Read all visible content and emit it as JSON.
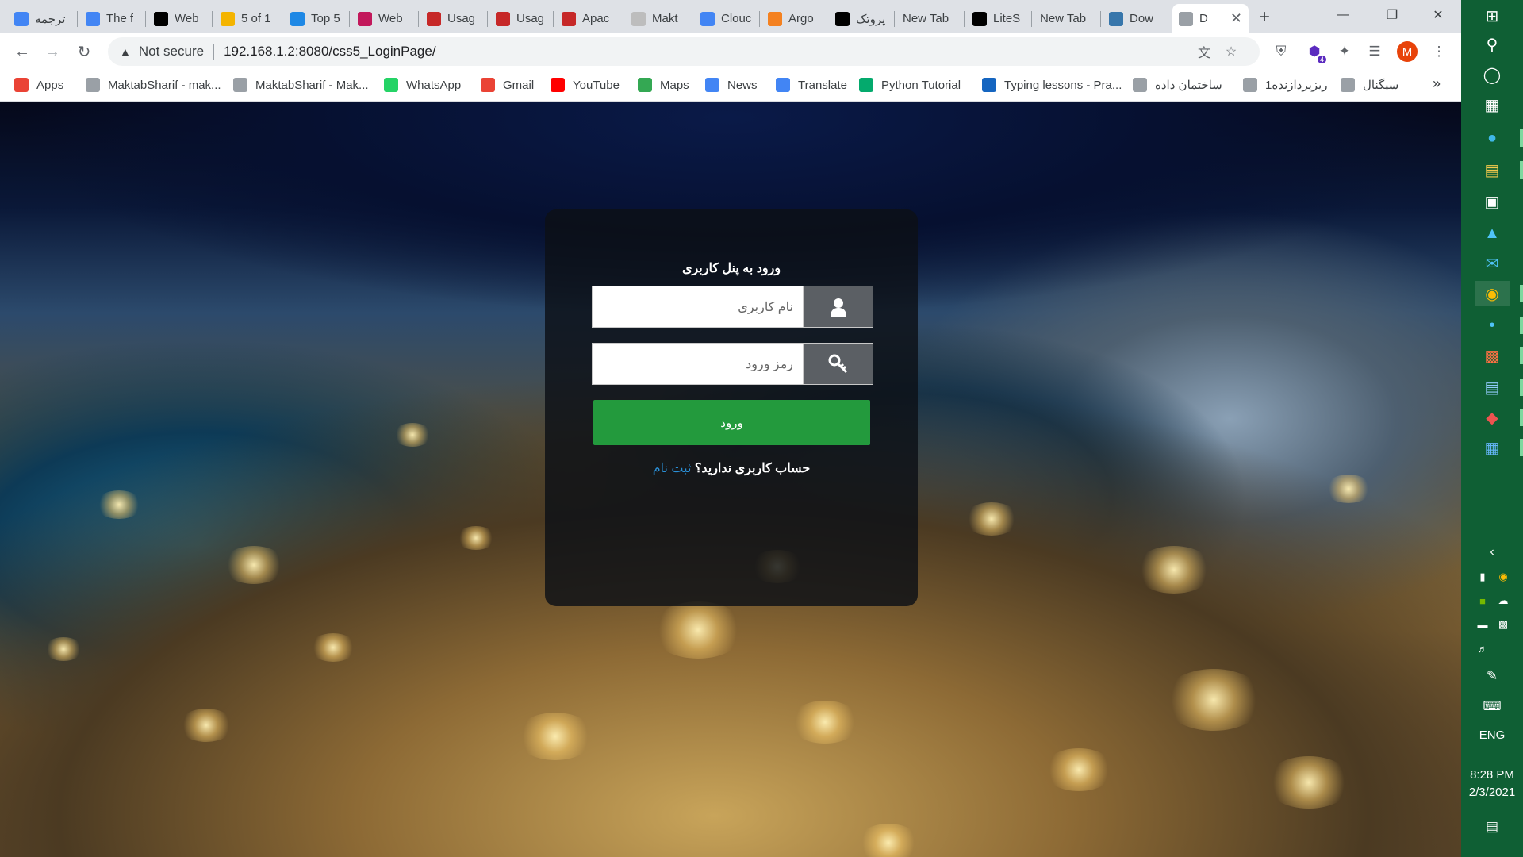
{
  "browser": {
    "tabs": [
      {
        "title": "ترجمه",
        "favicon": "translate-icon",
        "color": "#4285f4"
      },
      {
        "title": "The f",
        "favicon": "google-icon",
        "color": "#4285f4"
      },
      {
        "title": "Web",
        "favicon": "wikipedia-icon",
        "color": "#000000"
      },
      {
        "title": "5 of 1",
        "favicon": "mail-icon",
        "color": "#f4b400"
      },
      {
        "title": "Top 5",
        "favicon": "site-icon",
        "color": "#1e88e5"
      },
      {
        "title": "Web",
        "favicon": "site-icon",
        "color": "#c2185b"
      },
      {
        "title": "Usag",
        "favicon": "w3techs-icon",
        "color": "#c62828"
      },
      {
        "title": "Usag",
        "favicon": "w3techs-icon",
        "color": "#c62828"
      },
      {
        "title": "Apac",
        "favicon": "w3techs-icon",
        "color": "#c62828"
      },
      {
        "title": "Makt",
        "favicon": "globe-icon",
        "color": "#bdbdbd"
      },
      {
        "title": "Clouc",
        "favicon": "google-icon",
        "color": "#4285f4"
      },
      {
        "title": "Argo",
        "favicon": "cloudflare-icon",
        "color": "#f48120"
      },
      {
        "title": "پروتک",
        "favicon": "wikipedia-icon",
        "color": "#000000"
      },
      {
        "title": "New Tab",
        "favicon": "",
        "color": ""
      },
      {
        "title": "LiteS",
        "favicon": "wikipedia-icon",
        "color": "#000000"
      },
      {
        "title": "New Tab",
        "favicon": "",
        "color": ""
      },
      {
        "title": "Dow",
        "favicon": "python-icon",
        "color": "#3776ab"
      },
      {
        "title": "D",
        "favicon": "globe-icon",
        "color": "#9aa0a6",
        "active": true
      }
    ],
    "new_tab_symbol": "+",
    "address": {
      "security_label": "Not secure",
      "url": "192.168.1.2:8080/css5_LoginPage/"
    },
    "profile_initial": "M",
    "extension_badge": "4",
    "bookmarks": [
      {
        "label": "Apps",
        "icon": "apps-grid-icon",
        "color": "#ea4335"
      },
      {
        "label": "MaktabSharif - mak...",
        "icon": "globe-icon",
        "color": "#9aa0a6"
      },
      {
        "label": "MaktabSharif - Mak...",
        "icon": "globe-icon",
        "color": "#9aa0a6"
      },
      {
        "label": "WhatsApp",
        "icon": "whatsapp-icon",
        "color": "#25d366"
      },
      {
        "label": "Gmail",
        "icon": "gmail-icon",
        "color": "#ea4335"
      },
      {
        "label": "YouTube",
        "icon": "youtube-icon",
        "color": "#ff0000"
      },
      {
        "label": "Maps",
        "icon": "maps-icon",
        "color": "#34a853"
      },
      {
        "label": "News",
        "icon": "news-icon",
        "color": "#4285f4"
      },
      {
        "label": "Translate",
        "icon": "translate-icon",
        "color": "#4285f4"
      },
      {
        "label": "Python Tutorial",
        "icon": "w3schools-icon",
        "color": "#04aa6d"
      },
      {
        "label": "Typing lessons - Pra...",
        "icon": "typing-icon",
        "color": "#1565c0"
      },
      {
        "label": "ساختمان داده",
        "icon": "bank-icon",
        "color": "#9aa0a6"
      },
      {
        "label": "ریزپردازنده1",
        "icon": "bank-icon",
        "color": "#9aa0a6"
      },
      {
        "label": "سیگنال",
        "icon": "bank-icon",
        "color": "#9aa0a6"
      }
    ],
    "bookmarks_overflow": "»"
  },
  "login": {
    "title": "ورود به پنل کاربری",
    "username_placeholder": "نام کاربری",
    "password_placeholder": "رمز ورود",
    "submit_label": "ورود",
    "no_account_text": "حساب کاربری ندارید؟",
    "signup_link": "ثبت نام"
  },
  "taskbar": {
    "language": "ENG",
    "time": "8:28 PM",
    "date": "2/3/2021"
  },
  "colors": {
    "taskbar": "#0f5f34",
    "login_button": "#239a3d",
    "signup_link": "#2a8fd6"
  }
}
